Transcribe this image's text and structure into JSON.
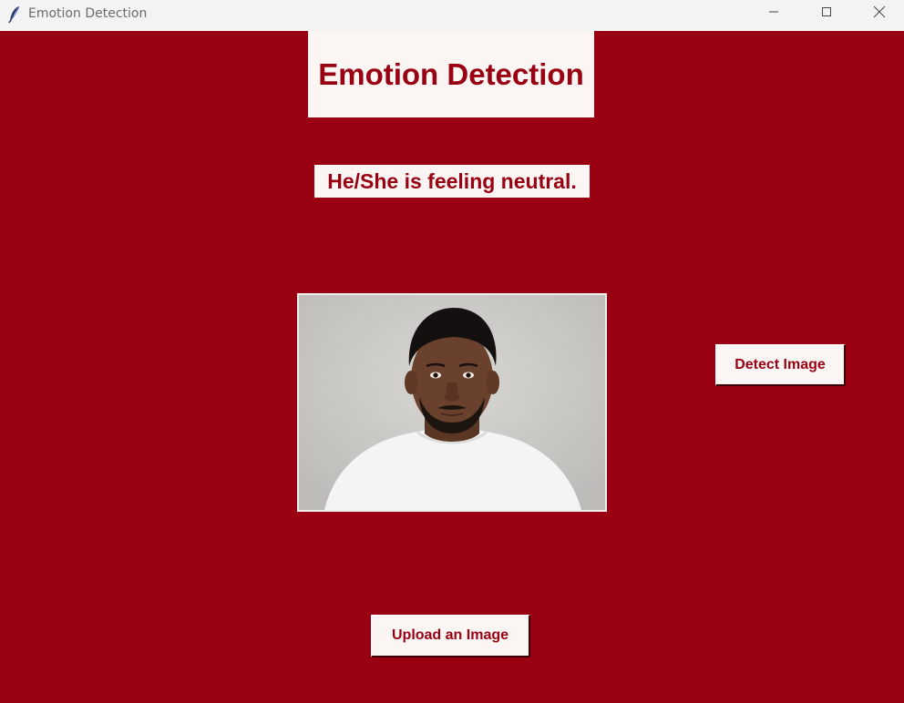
{
  "window": {
    "title": "Emotion Detection",
    "icon": "feather-icon",
    "controls": [
      "minimize-icon",
      "maximize-icon",
      "close-icon"
    ]
  },
  "app": {
    "heading": "Emotion Detection",
    "result_text": "He/She is feeling neutral.",
    "detect_button_label": "Detect Image",
    "upload_button_label": "Upload an Image"
  },
  "colors": {
    "background": "#990012",
    "panel": "#fbf5f3",
    "text_accent": "#990012",
    "titlebar": "#f3f3f3"
  }
}
